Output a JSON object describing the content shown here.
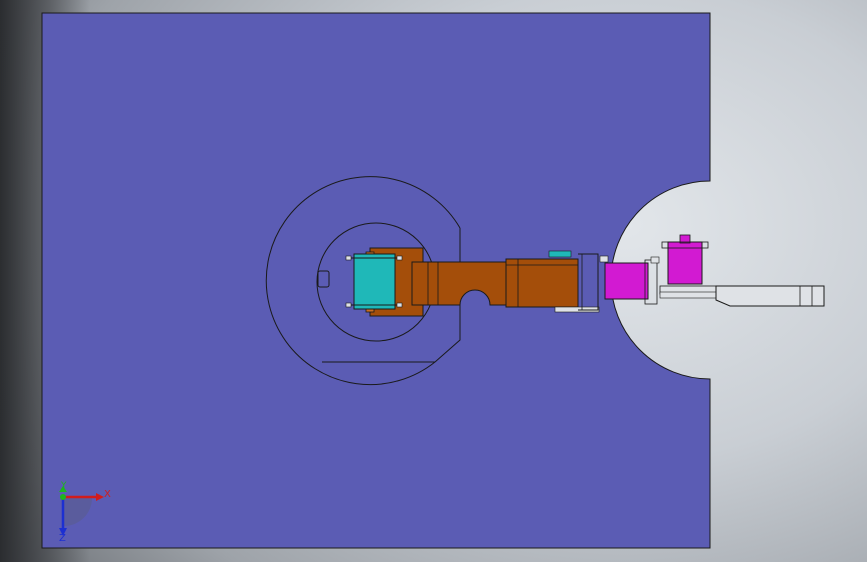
{
  "viewport": {
    "background": "#cfd3d8",
    "plate_color": "#5b5cb4",
    "outline_color": "#1a1a1a"
  },
  "model": {
    "base_color": "#5b5cb4",
    "servo_cyan_color": "#1fb8b8",
    "arm_link_color": "#a44e0a",
    "gripper_servo_color": "#d21ad2",
    "gripper_finger_color": "#dfe2e6"
  },
  "triad": {
    "x_label": "X",
    "y_label": "Y",
    "z_label": "Z",
    "x_color": "#d11c1c",
    "y_color": "#1db51d",
    "z_color": "#1c2fd1"
  }
}
